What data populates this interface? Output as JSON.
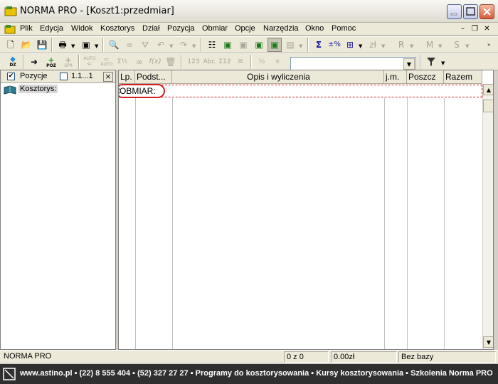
{
  "window": {
    "title": "NORMA PRO - [Koszt1:przedmiar]"
  },
  "menu": [
    "Plik",
    "Edycja",
    "Widok",
    "Kosztorys",
    "Dział",
    "Pozycja",
    "Obmiar",
    "Opcje",
    "Narzędzia",
    "Okno",
    "Pomoc"
  ],
  "toolbar2": {
    "b1": "DZ",
    "b2": "POZ",
    "b3": "SPR",
    "b4": "AUTO",
    "b5": "AUTO",
    "b6": "123",
    "b7": "Abc",
    "b8": "Σ12"
  },
  "left_panel": {
    "pozycje_label": "Pozycje",
    "range_label": "1.1...1",
    "close": "×",
    "tree_root": "Kosztorys:"
  },
  "grid": {
    "columns": [
      "Lp.",
      "Podst...",
      "Opis i wyliczenia",
      "j.m.",
      "Poszcz",
      "Razem"
    ],
    "first_row": "OBMIAR:"
  },
  "status": {
    "app": "NORMA PRO",
    "count": "0 z 0",
    "amount": "0.00zł",
    "base": "Bez bazy"
  },
  "footer": {
    "text": "www.astino.pl  ▪  (22) 8 555 404  ▪  (52) 327 27 27  ▪  Programy do kosztorysowania  ▪  Kursy kosztorysowania  ▪  Szkolenia Norma PRO"
  },
  "colors": {
    "highlight_red": "#d22020",
    "footer_bg": "#2f2f2f",
    "grid_border": "#808080"
  }
}
